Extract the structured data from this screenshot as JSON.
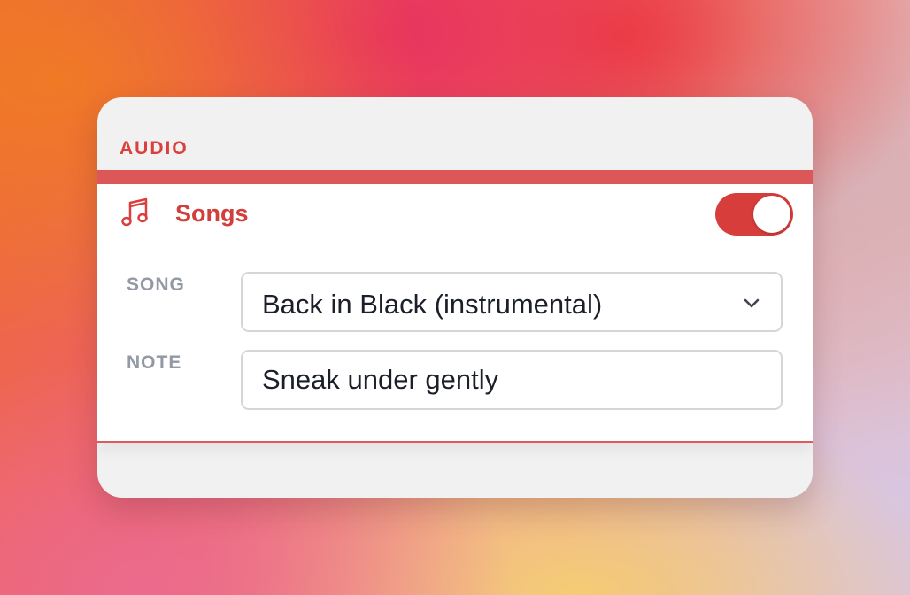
{
  "section": {
    "title": "AUDIO"
  },
  "songs": {
    "label": "Songs",
    "icon": "music-note-icon",
    "toggle_on": true,
    "accent_color": "#d63d3b"
  },
  "fields": {
    "song_label": "SONG",
    "song_value": "Back in Black (instrumental)",
    "note_label": "NOTE",
    "note_value": "Sneak under gently"
  }
}
